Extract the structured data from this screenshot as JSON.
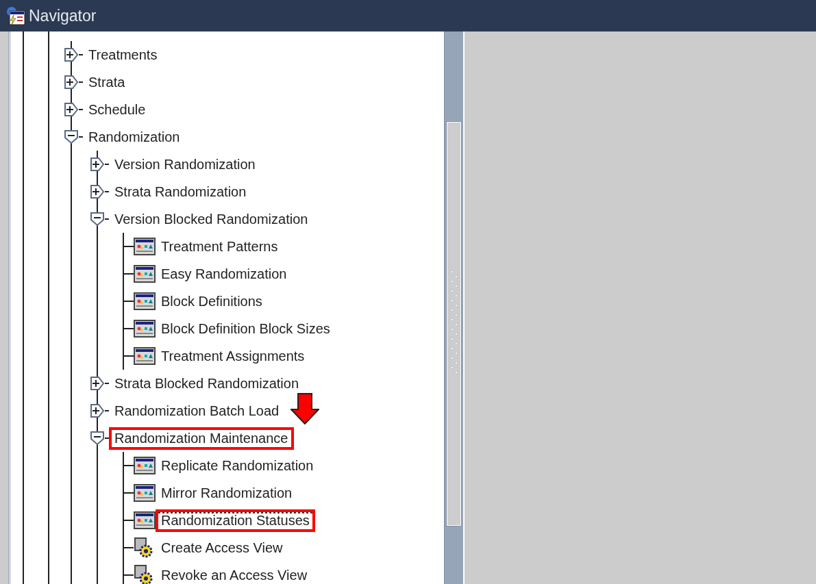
{
  "window": {
    "title": "Navigator"
  },
  "tree": [
    {
      "label": "Treatments",
      "kind": "folder",
      "expanded": false,
      "highlighted": false,
      "focused": false
    },
    {
      "label": "Strata",
      "kind": "folder",
      "expanded": false,
      "highlighted": false,
      "focused": false
    },
    {
      "label": "Schedule",
      "kind": "folder",
      "expanded": false,
      "highlighted": false,
      "focused": false
    },
    {
      "label": "Randomization",
      "kind": "folder",
      "expanded": true,
      "highlighted": false,
      "focused": false,
      "children": [
        {
          "label": "Version Randomization",
          "kind": "folder",
          "expanded": false,
          "highlighted": false,
          "focused": false
        },
        {
          "label": "Strata Randomization",
          "kind": "folder",
          "expanded": false,
          "highlighted": false,
          "focused": false
        },
        {
          "label": "Version Blocked Randomization",
          "kind": "folder",
          "expanded": true,
          "highlighted": false,
          "focused": false,
          "children": [
            {
              "label": "Treatment Patterns",
              "kind": "form",
              "highlighted": false,
              "focused": false
            },
            {
              "label": "Easy Randomization",
              "kind": "form",
              "highlighted": false,
              "focused": false
            },
            {
              "label": "Block Definitions",
              "kind": "form",
              "highlighted": false,
              "focused": false
            },
            {
              "label": "Block Definition Block Sizes",
              "kind": "form",
              "highlighted": false,
              "focused": false
            },
            {
              "label": "Treatment Assignments",
              "kind": "form",
              "highlighted": false,
              "focused": false
            }
          ]
        },
        {
          "label": "Strata Blocked Randomization",
          "kind": "folder",
          "expanded": false,
          "highlighted": false,
          "focused": false
        },
        {
          "label": "Randomization Batch Load",
          "kind": "folder",
          "expanded": false,
          "highlighted": false,
          "focused": false
        },
        {
          "label": "Randomization Maintenance",
          "kind": "folder",
          "expanded": true,
          "highlighted": true,
          "focused": false,
          "children": [
            {
              "label": "Replicate Randomization",
              "kind": "form",
              "highlighted": false,
              "focused": false
            },
            {
              "label": "Mirror Randomization",
              "kind": "form",
              "highlighted": false,
              "focused": false
            },
            {
              "label": "Randomization Statuses",
              "kind": "form",
              "highlighted": true,
              "focused": true
            },
            {
              "label": "Create Access View",
              "kind": "process",
              "highlighted": false,
              "focused": false
            },
            {
              "label": "Revoke an Access View",
              "kind": "process",
              "highlighted": false,
              "focused": false
            }
          ]
        }
      ]
    }
  ]
}
